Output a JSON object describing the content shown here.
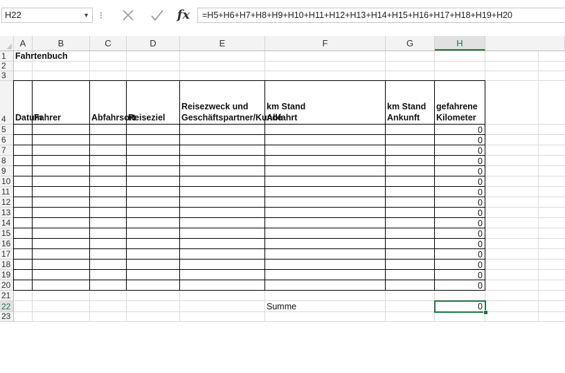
{
  "formula_bar": {
    "name_box": "H22",
    "separator": "⁝",
    "fx_label": "fx",
    "formula": "=H5+H6+H7+H8+H9+H10+H11+H12+H13+H14+H15+H16+H17+H18+H19+H20"
  },
  "columns": [
    "A",
    "B",
    "C",
    "D",
    "E",
    "F",
    "G",
    "H"
  ],
  "rows": [
    "1",
    "2",
    "3",
    "4",
    "5",
    "6",
    "7",
    "8",
    "9",
    "10",
    "11",
    "12",
    "13",
    "14",
    "15",
    "16",
    "17",
    "18",
    "19",
    "20",
    "21",
    "22",
    "23"
  ],
  "sheet": {
    "title": "Fahrtenbuch",
    "headers": {
      "datum": "Datum",
      "fahrer": "Fahrer",
      "abfahrtsort": "Abfahrsort",
      "reiseziel": "Reiseziel",
      "reisezweck_line1": "Reisezweck und",
      "reisezweck_line2": "Geschäftspartner/Kunde",
      "km_abfahrt_line1": "km Stand",
      "km_abfahrt_line2": "Abfahrt",
      "km_ankunft_line1": "km Stand",
      "km_ankunft_line2": "Ankunft",
      "km_gefahren_line1": "gefahrene",
      "km_gefahren_line2": "Kilometer"
    },
    "kilometer_values": [
      "0",
      "0",
      "0",
      "0",
      "0",
      "0",
      "0",
      "0",
      "0",
      "0",
      "0",
      "0",
      "0",
      "0",
      "0",
      "0"
    ],
    "summe_label": "Summe",
    "summe_value": "0"
  },
  "selection": {
    "active_cell": "H22",
    "active_column": "H",
    "active_row": "22"
  },
  "colors": {
    "accent": "#217346",
    "border": "#000000",
    "gridline": "#dadada"
  }
}
